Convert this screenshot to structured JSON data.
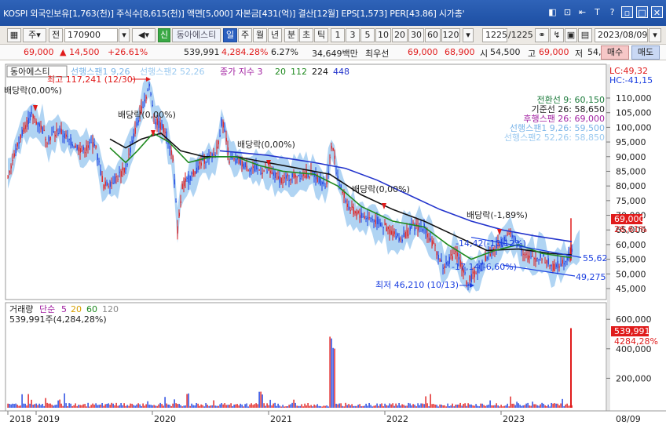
{
  "window": {
    "title": "KOSPI 외국인보유[1,763(천)] 주식수[8,615(천)] 액면[5,000] 자본금[431(억)] 결산[12월] EPS[1,573] PER[43.86] 시가총'",
    "buttons": [
      "◧",
      "⊡",
      "⇤",
      "T",
      "?",
      "▫",
      "□",
      "✕"
    ]
  },
  "toolbar": {
    "market": "주",
    "period_label": "전",
    "code": "170900",
    "sound_icon": "speaker-icon",
    "new_badge": "신",
    "stock_name": "동아에스티",
    "periods": [
      "일",
      "주",
      "월",
      "년",
      "분",
      "초",
      "틱"
    ],
    "active_period": "일",
    "intervals": [
      "1",
      "3",
      "5",
      "10",
      "20",
      "30",
      "60",
      "120"
    ],
    "count": "1225",
    "count_total": "/1225",
    "date": "2023/08/09"
  },
  "quote": {
    "price": "69,000",
    "change": "▲ 14,500",
    "change_pct": "+26.61%",
    "volume": "539,991",
    "volume_ratio": "4,284.28%",
    "turnover": "6.27%",
    "amount": "34,649백만",
    "priority_label": "최우선",
    "ask": "69,000",
    "bid": "68,900",
    "open_label": "시",
    "open": "54,500",
    "high_label": "고",
    "high": "69,000",
    "low_label": "저",
    "low": "54,500",
    "buy": "매수",
    "sell": "매도"
  },
  "legend": {
    "name": "동아에스티",
    "span1": "선행스팬1 9,26",
    "span2": "선행스팬2 52,26",
    "ma_label": "종가 지수 3",
    "ma_periods": [
      "20",
      "112",
      "224",
      "448"
    ],
    "lc": "LC:49,32",
    "hc": "HC:-41,15"
  },
  "ichimoku_info": [
    {
      "text": "전환선 9: 60,150",
      "color": "#1a7a3a"
    },
    {
      "text": "기준선 26: 58,650",
      "color": "#222222"
    },
    {
      "text": "후행스팬 26: 69,000",
      "color": "#a01ea0"
    },
    {
      "text": "선행스팬1 9,26: 59,500",
      "color": "#7ab4e8"
    },
    {
      "text": "선행스팬2 52,26: 58,850",
      "color": "#9ccaf0"
    }
  ],
  "annotations": {
    "dividend": [
      "배당락(0,00%)",
      "배당락(0,00%)",
      "배당락(0,00%)",
      "배당락(0,00%)",
      "배당락(-1,89%)"
    ],
    "high": "최고 117,241 (12/30)",
    "low": "최저 46,210 (10/13)",
    "ch1": "-14,42(-10,12%)",
    "ch2": "-17,14(-6,60%)",
    "trend_top": "55,62",
    "trend_bottom": "49,275"
  },
  "volume_panel": {
    "label": "거래량",
    "ma_label": "단순",
    "ma_periods": [
      "5",
      "20",
      "60",
      "120"
    ],
    "current": "539,991주(4,284,28%)",
    "current_value": "539,991",
    "current_ratio": "4284,28%"
  },
  "price_axis": {
    "ticks": [
      "110,000",
      "105,000",
      "100,000",
      "95,000",
      "90,000",
      "85,000",
      "80,000",
      "75,000",
      "70,000",
      "65,000",
      "60,000",
      "55,000",
      "50,000",
      "45,000"
    ],
    "current": "69,000",
    "current_pct": "26,61%"
  },
  "volume_axis": {
    "ticks": [
      "600,000",
      "400,000",
      "200,000"
    ]
  },
  "date_axis": {
    "labels": [
      "2018",
      "2019",
      "2020",
      "2021",
      "2022",
      "2023"
    ],
    "end_label": "08/09"
  },
  "colors": {
    "candle_up": "#e01b1b",
    "candle_down": "#1b3fe0",
    "ma20": "#1f8a1f",
    "ma112": "#111111",
    "ma448": "#2233cc",
    "cloud": "#6fb0ea"
  }
}
